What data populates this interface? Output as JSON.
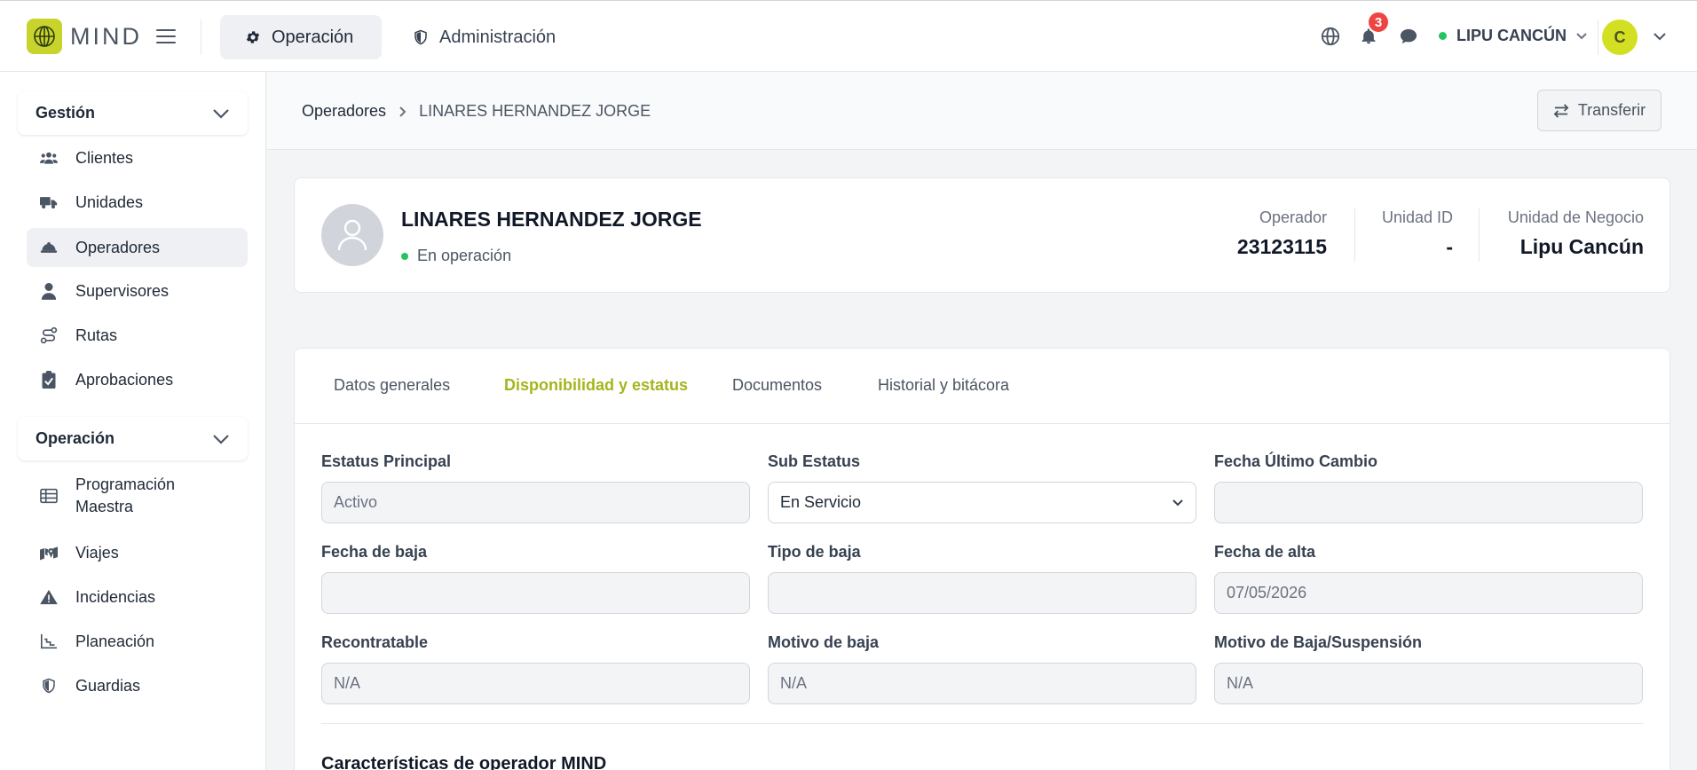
{
  "header": {
    "logo_text": "MIND",
    "nav_tabs": [
      {
        "label": "Operación",
        "active": true,
        "icon": "gear-icon"
      },
      {
        "label": "Administración",
        "active": false,
        "icon": "shield-icon"
      }
    ],
    "notification_count": "3",
    "business_unit": "LIPU CANCÚN",
    "user_initial": "C"
  },
  "sidebar": {
    "sections": [
      {
        "title": "Gestión",
        "items": [
          {
            "label": "Clientes",
            "icon": "users-icon"
          },
          {
            "label": "Unidades",
            "icon": "truck-icon"
          },
          {
            "label": "Operadores",
            "icon": "hard-hat-icon",
            "active": true
          },
          {
            "label": "Supervisores",
            "icon": "user-tie-icon"
          },
          {
            "label": "Rutas",
            "icon": "route-icon"
          },
          {
            "label": "Aprobaciones",
            "icon": "clipboard-check-icon"
          }
        ]
      },
      {
        "title": "Operación",
        "items": [
          {
            "label": "Programación Maestra",
            "icon": "table-list-icon"
          },
          {
            "label": "Viajes",
            "icon": "map-location-icon"
          },
          {
            "label": "Incidencias",
            "icon": "warning-icon"
          },
          {
            "label": "Planeación",
            "icon": "chart-line-icon"
          },
          {
            "label": "Guardias",
            "icon": "shield-half-icon"
          }
        ]
      }
    ]
  },
  "breadcrumb": {
    "parent": "Operadores",
    "current": "LINARES HERNANDEZ JORGE"
  },
  "actions": {
    "transfer_label": "Transferir"
  },
  "profile": {
    "name": "LINARES HERNANDEZ JORGE",
    "status": "En operación",
    "stats": [
      {
        "label": "Operador",
        "value": "23123115"
      },
      {
        "label": "Unidad ID",
        "value": "-"
      },
      {
        "label": "Unidad de Negocio",
        "value": "Lipu Cancún"
      }
    ]
  },
  "tabs": [
    {
      "label": "Datos generales",
      "active": false
    },
    {
      "label": "Disponibilidad y estatus",
      "active": true
    },
    {
      "label": "Documentos",
      "active": false
    },
    {
      "label": "Historial y bitácora",
      "active": false
    }
  ],
  "form": {
    "estatus_principal": {
      "label": "Estatus Principal",
      "value": "Activo"
    },
    "sub_estatus": {
      "label": "Sub Estatus",
      "value": "En Servicio"
    },
    "fecha_ultimo_cambio": {
      "label": "Fecha Último Cambio",
      "value": ""
    },
    "fecha_baja": {
      "label": "Fecha de baja",
      "value": ""
    },
    "tipo_baja": {
      "label": "Tipo de baja",
      "value": ""
    },
    "fecha_alta": {
      "label": "Fecha de alta",
      "value": "07/05/2026"
    },
    "recontratable": {
      "label": "Recontratable",
      "value": "N/A"
    },
    "motivo_baja": {
      "label": "Motivo de baja",
      "value": "N/A"
    },
    "motivo_baja_suspension": {
      "label": "Motivo de Baja/Suspensión",
      "value": "N/A"
    }
  },
  "section_title": "Características de operador MIND",
  "colors": {
    "brand": "#c8d42c",
    "active_tab": "#a5b51c",
    "status_online": "#22c55e",
    "badge": "#ef4444"
  }
}
